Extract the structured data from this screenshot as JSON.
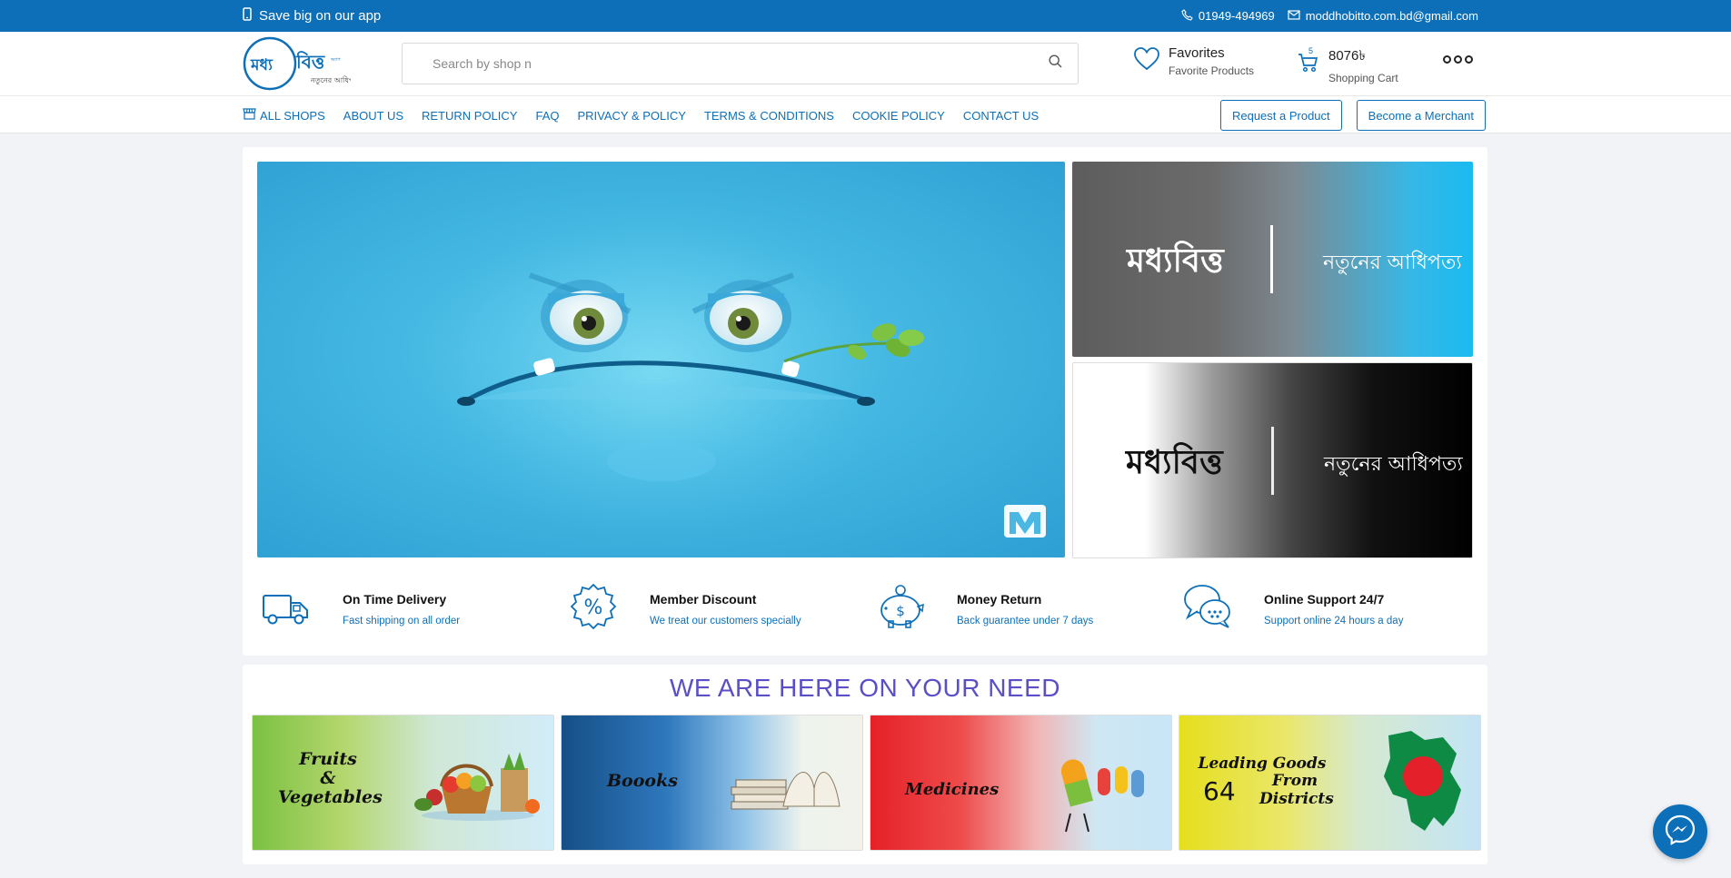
{
  "topbar": {
    "app_promo": "Save big on our app",
    "phone": "01949-494969",
    "email": "moddhobitto.com.bd@gmail.com"
  },
  "header": {
    "logo_text": "মধ্যবিত্ত",
    "logo_tagline": "নতুনের আধিপত্য",
    "search": {
      "placeholder": "Search by shop n",
      "value": ""
    },
    "favorites": {
      "title": "Favorites",
      "subtitle": "Favorite Products"
    },
    "cart": {
      "count": "5",
      "amount": "8076৳",
      "subtitle": "Shopping Cart"
    }
  },
  "nav": {
    "links": [
      {
        "label": "ALL SHOPS",
        "icon": "store-icon"
      },
      {
        "label": "ABOUT US"
      },
      {
        "label": "RETURN POLICY"
      },
      {
        "label": "FAQ"
      },
      {
        "label": "PRIVACY & POLICY"
      },
      {
        "label": "TERMS & CONDITIONS"
      },
      {
        "label": "COOKIE POLICY"
      },
      {
        "label": "CONTACT US"
      }
    ],
    "buttons": {
      "request": "Request a Product",
      "merchant": "Become a Merchant"
    }
  },
  "banners": {
    "side1": {
      "brand": "মধ্যবিত্ত",
      "tagline": "নতুনের আধিপত্য"
    },
    "side2": {
      "brand": "মধ্যবিত্ত",
      "tagline": "নতুনের আধিপত্য"
    }
  },
  "features": [
    {
      "title": "On Time Delivery",
      "subtitle": "Fast shipping on all order",
      "icon": "truck-icon"
    },
    {
      "title": "Member Discount",
      "subtitle": "We treat our customers specially",
      "icon": "discount-badge-icon"
    },
    {
      "title": "Money Return",
      "subtitle": "Back guarantee under 7 days",
      "icon": "piggy-bank-icon"
    },
    {
      "title": "Online Support 24/7",
      "subtitle": "Support online 24 hours a day",
      "icon": "chat-bubbles-icon"
    }
  ],
  "need": {
    "title": "WE ARE HERE ON YOUR NEED",
    "categories": [
      {
        "label": "Fruits & Vegetables",
        "line1": "Fruits",
        "line2": "&",
        "line3": "Vegetables"
      },
      {
        "label": "Boooks"
      },
      {
        "label": "Medicines"
      },
      {
        "label": "Leading Goods From 64 Districts",
        "line1": "Leading Goods",
        "line2": "64",
        "line3": "From",
        "line4": "Districts"
      }
    ]
  },
  "colors": {
    "brand": "#0d6fb8",
    "title": "#5a4fc7"
  }
}
